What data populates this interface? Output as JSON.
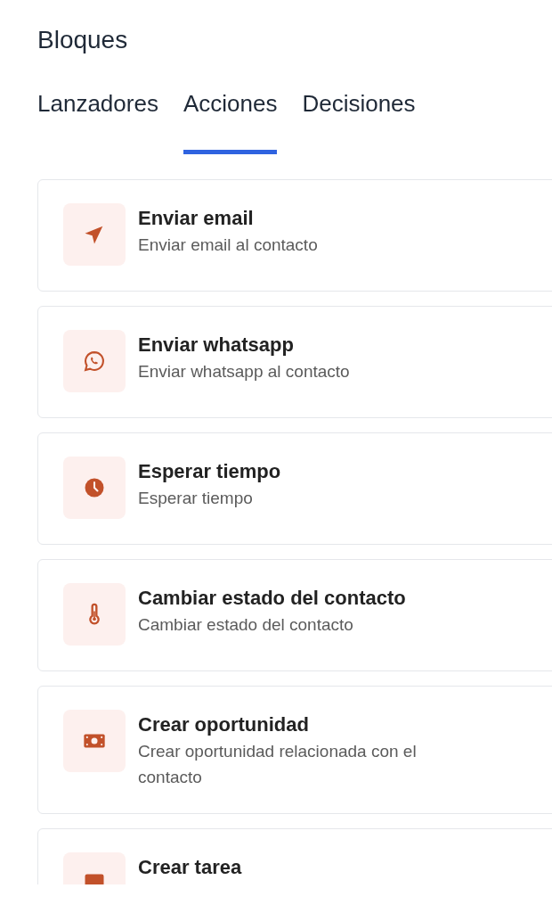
{
  "title": "Bloques",
  "tabs": [
    {
      "label": "Lanzadores",
      "selected": false
    },
    {
      "label": "Acciones",
      "selected": true
    },
    {
      "label": "Decisiones",
      "selected": false
    }
  ],
  "blocks": [
    {
      "kind": "send",
      "title": "Enviar email",
      "description": "Enviar email al contacto"
    },
    {
      "kind": "whatsapp",
      "title": "Enviar whatsapp",
      "description": "Enviar whatsapp al contacto"
    },
    {
      "kind": "clock",
      "title": "Esperar tiempo",
      "description": "Esperar tiempo"
    },
    {
      "kind": "thermometer",
      "title": "Cambiar estado del contacto",
      "description": "Cambiar estado del contacto"
    },
    {
      "kind": "money",
      "title": "Crear oportunidad",
      "description": "Crear oportunidad relacionada con el contacto"
    },
    {
      "kind": "task",
      "title": "Crear tarea"
    }
  ]
}
